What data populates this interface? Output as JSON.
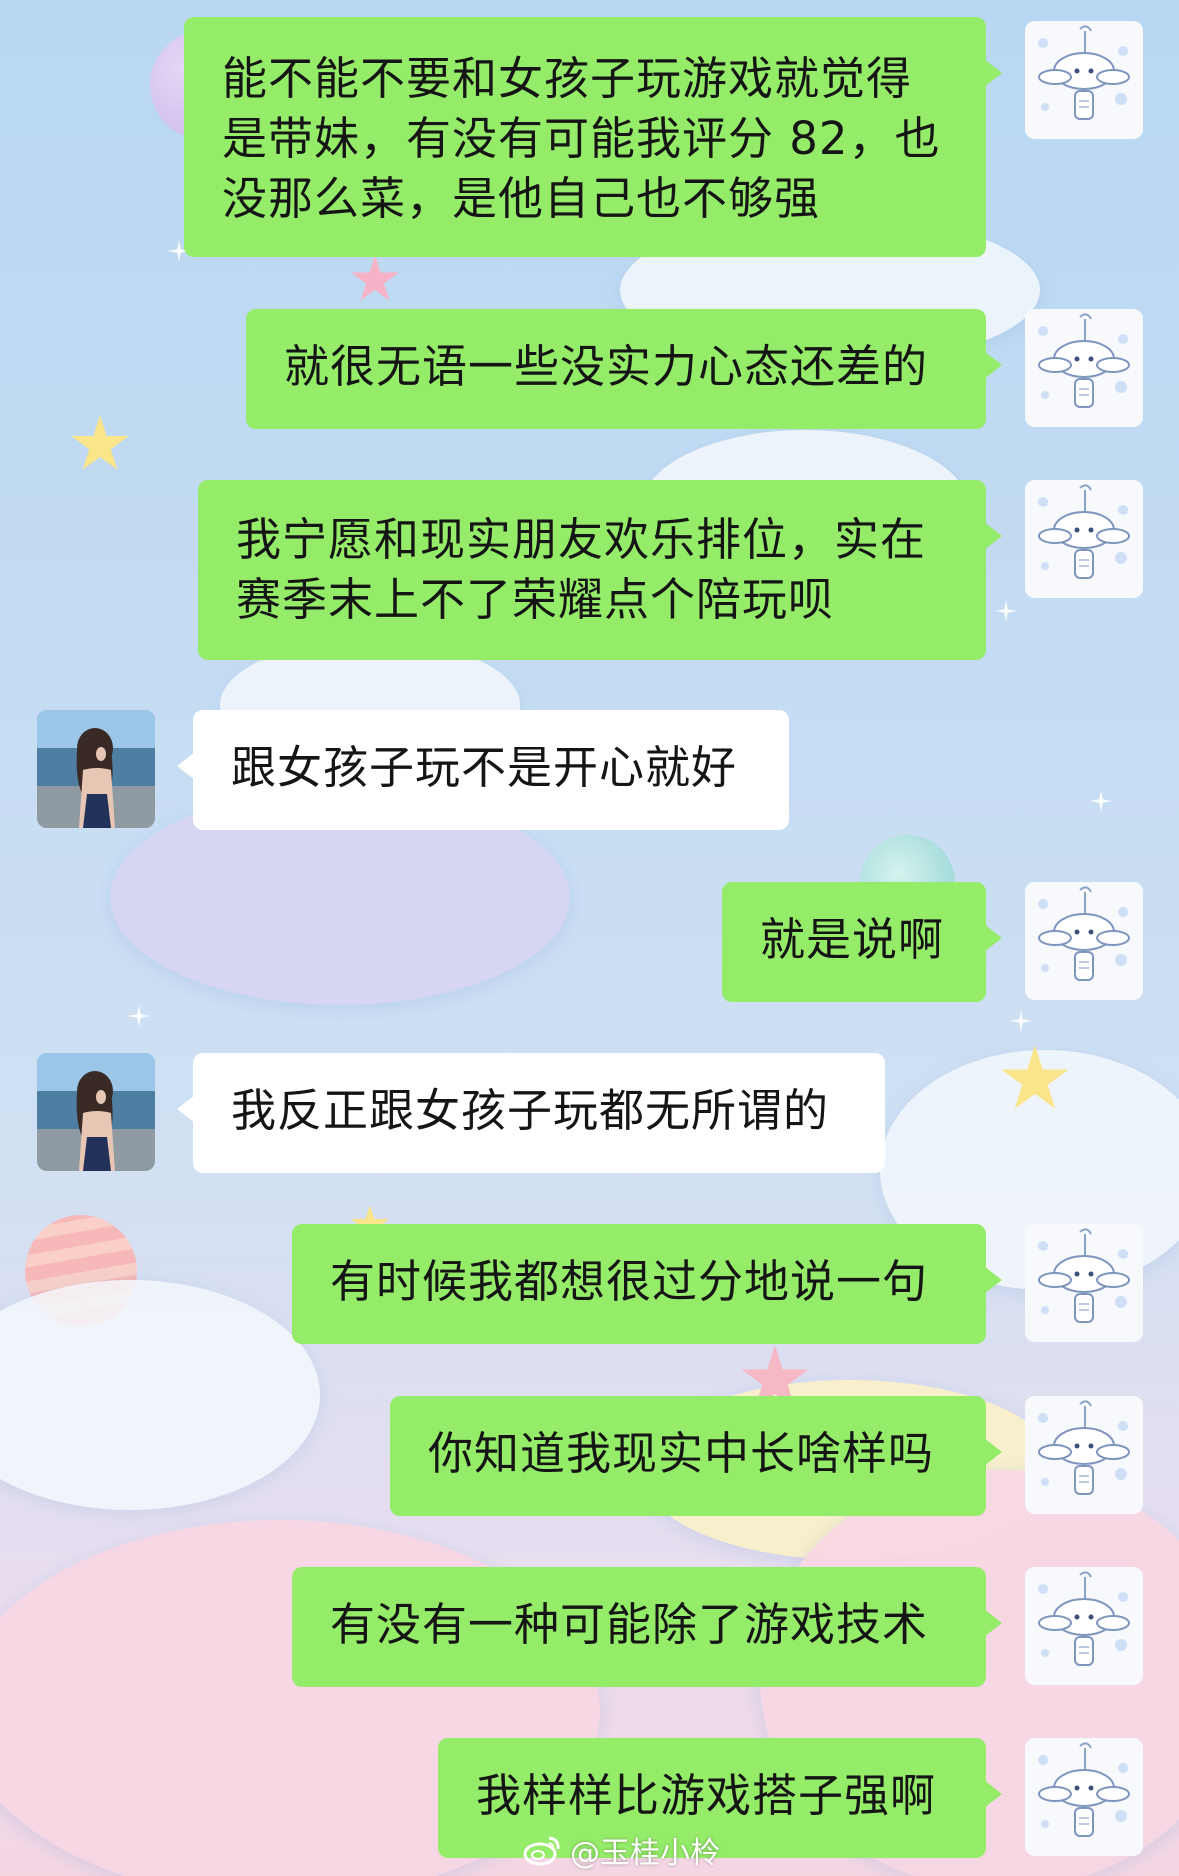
{
  "colors": {
    "self_bubble": "#95ec69",
    "other_bubble": "#ffffff",
    "text": "#151515"
  },
  "avatars": {
    "self": "cinnamoroll-dog-icon",
    "other": "girl-at-sea-photo"
  },
  "messages": [
    {
      "sender": "self",
      "text": "能不能不要和女孩子玩游戏就觉得\n是带妹，有没有可能我评分 82，也\n没那么菜，是他自己也不够强"
    },
    {
      "sender": "self",
      "text": "就很无语一些没实力心态还差的"
    },
    {
      "sender": "self",
      "text": "我宁愿和现实朋友欢乐排位，实在\n赛季末上不了荣耀点个陪玩呗"
    },
    {
      "sender": "other",
      "text": "跟女孩子玩不是开心就好"
    },
    {
      "sender": "self",
      "text": "就是说啊"
    },
    {
      "sender": "other",
      "text": "我反正跟女孩子玩都无所谓的"
    },
    {
      "sender": "self",
      "text": "有时候我都想很过分地说一句"
    },
    {
      "sender": "self",
      "text": "你知道我现实中长啥样吗"
    },
    {
      "sender": "self",
      "text": "有没有一种可能除了游戏技术"
    },
    {
      "sender": "self",
      "text": "我样样比游戏搭子强啊"
    }
  ],
  "watermark": {
    "text": "@玉桂小柃",
    "icon": "weibo-logo-icon"
  }
}
